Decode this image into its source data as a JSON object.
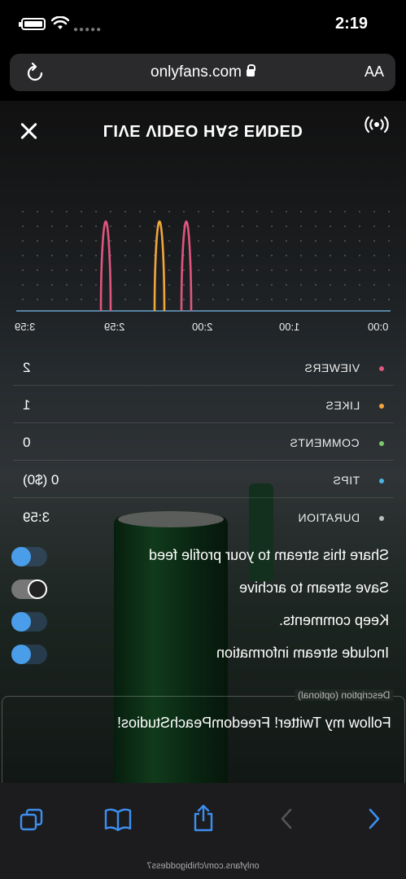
{
  "status": {
    "time": "2:19"
  },
  "browser": {
    "url": "onlyfans.com",
    "text_size_label": "AA"
  },
  "stream": {
    "title": "LIVE VIDEO HAS ENDED",
    "ticks": [
      "3:59",
      "2:59",
      "2:00",
      "1:00",
      "0:00"
    ],
    "stats": [
      {
        "label": "VIEWERS",
        "value": "2",
        "color": "#e0567f"
      },
      {
        "label": "LIKES",
        "value": "1",
        "color": "#f2a63c"
      },
      {
        "label": "COMMENTS",
        "value": "0",
        "color": "#7ec96b"
      },
      {
        "label": "TIPS",
        "value": "0 ($0)",
        "color": "#4ab4e0"
      },
      {
        "label": "DURATION",
        "value": "3:59",
        "color": "#bbbbbb"
      }
    ],
    "options": [
      {
        "label": "Share this stream to your profile feed",
        "on": true
      },
      {
        "label": "Save stream to archive",
        "on": false
      },
      {
        "label": "Keep comments.",
        "on": true
      },
      {
        "label": "Include stream information",
        "on": true
      }
    ],
    "description_label": "Description (optional)",
    "description_text": "Follow my Twitter! FreedomPeachStudios!"
  },
  "chart_data": {
    "type": "line",
    "x": [
      "3:59",
      "2:59",
      "2:00",
      "1:00",
      "0:00"
    ],
    "series": [
      {
        "name": "VIEWERS",
        "color": "#e0567f",
        "peaks": [
          3.0,
          2.1
        ]
      },
      {
        "name": "LIKES",
        "color": "#f2a63c",
        "peaks": [
          2.4
        ]
      }
    ]
  },
  "footer_url": "onlyfans.com/chibigoddess7"
}
